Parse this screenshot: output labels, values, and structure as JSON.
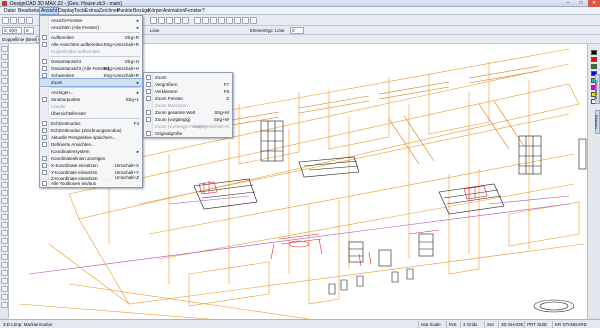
{
  "window": {
    "title": "DesignCAD 3D MAX 22 - [Geo. House.dc3 - main]",
    "min_label": "–",
    "max_label": "□",
    "close_label": "✕"
  },
  "menubar": {
    "items": [
      {
        "label": "Datei"
      },
      {
        "label": "Bearbeiten"
      },
      {
        "label": "Ansicht"
      },
      {
        "label": "Display"
      },
      {
        "label": "Tools"
      },
      {
        "label": "Extras"
      },
      {
        "label": "Zeichnen"
      },
      {
        "label": "Punkte"
      },
      {
        "label": "Bezüge"
      },
      {
        "label": "Körper"
      },
      {
        "label": "Animation"
      },
      {
        "label": "Fenster"
      },
      {
        "label": "?"
      }
    ]
  },
  "toolbar": {
    "field_a": "0, 0(0)",
    "field_b": "0",
    "label_line": "Doppellinie (Breite):",
    "field_line": "0",
    "label_vol": "Voll",
    "label_style": "Linie",
    "label_elem": "Elementtyp: Linie",
    "field_elem": "0"
  },
  "ansicht_menu": {
    "items": [
      {
        "label": "Ansicht-Fenster",
        "shortcut": "",
        "arrow": "▸"
      },
      {
        "label": "Ansichten (Alle Fenster)",
        "shortcut": "",
        "arrow": "▸"
      },
      {
        "label": "Aufbereiten",
        "shortcut": "Strg+R"
      },
      {
        "label": "Alle Ansichten aufbereiten",
        "shortcut": "Strg+Umschalt+R"
      },
      {
        "label": "Doppelbilder aufbereiten",
        "shortcut": ""
      },
      {
        "label": "Gesamtansicht",
        "shortcut": "Strg+H"
      },
      {
        "label": "Gesamtansicht (Alle Fenster)",
        "shortcut": "Strg+Umschalt+H"
      },
      {
        "label": "Schwenken",
        "shortcut": "Strg+Umschalt+R"
      },
      {
        "label": "Zoom",
        "shortcut": "",
        "arrow": "▸"
      },
      {
        "label": "Anzeigen...",
        "shortcut": "",
        "arrow": "▸"
      },
      {
        "label": "Strukturpunkte",
        "shortcut": "Strg+1"
      },
      {
        "label": "Lineale",
        "shortcut": ""
      },
      {
        "label": "Übersichtsfenster",
        "shortcut": ""
      },
      {
        "label": "Echtzeitmodus",
        "shortcut": "F4"
      },
      {
        "label": "Echtzeitmodus (Zeichnungsmodus)",
        "shortcut": ""
      },
      {
        "label": "Aktuelle Perspektive speichern...",
        "shortcut": ""
      },
      {
        "label": "Definierte Ansichten...",
        "shortcut": ""
      },
      {
        "label": "Koordinatensystem",
        "shortcut": "",
        "arrow": "▸"
      },
      {
        "label": "Koordinatenlinien anzeigen",
        "shortcut": ""
      },
      {
        "label": "X-Koordinate einsetzen",
        "shortcut": "Umschalt+X"
      },
      {
        "label": "Y-Koordinate einsetzen",
        "shortcut": "Umschalt+Y"
      },
      {
        "label": "Z-Koordinate einsetzen",
        "shortcut": "Umschalt+Z"
      },
      {
        "label": "Alle Toolboxen ein/aus",
        "shortcut": ""
      }
    ]
  },
  "zoom_submenu": {
    "items": [
      {
        "label": "Zoom",
        "shortcut": ""
      },
      {
        "label": "Vergrößern",
        "shortcut": "F7"
      },
      {
        "label": "Verkleinern",
        "shortcut": "F8"
      },
      {
        "label": "Zoom Fenster",
        "shortcut": "Z"
      },
      {
        "label": "Zoom Markieren",
        "shortcut": ""
      },
      {
        "label": "Zoom gesamte Welt",
        "shortcut": "Strg+M"
      },
      {
        "label": "Zoom (vorgängig)",
        "shortcut": "Strg+W"
      },
      {
        "label": "Zoom (vorherige Fenster)",
        "shortcut": "Strg+Umschalt+M"
      },
      {
        "label": "Originalgröße",
        "shortcut": ""
      }
    ]
  },
  "statusbar": {
    "mode": "3:D Ltmp: Markiermodus",
    "cells": [
      "Ista Scale",
      "INS",
      "3 Grids",
      "Set",
      "3D SHADE",
      "PRT SIZE",
      "KR STANDARD"
    ]
  },
  "right_panel": {
    "tab1": "Zeichnung",
    "tab2": "Ebenen"
  },
  "colors": {
    "accent": "#c8dcf5",
    "wire_orange": "#e89a2e",
    "wire_black": "#1a1a1a",
    "wire_red": "#e0202a",
    "wire_purple": "#b04ab8"
  }
}
